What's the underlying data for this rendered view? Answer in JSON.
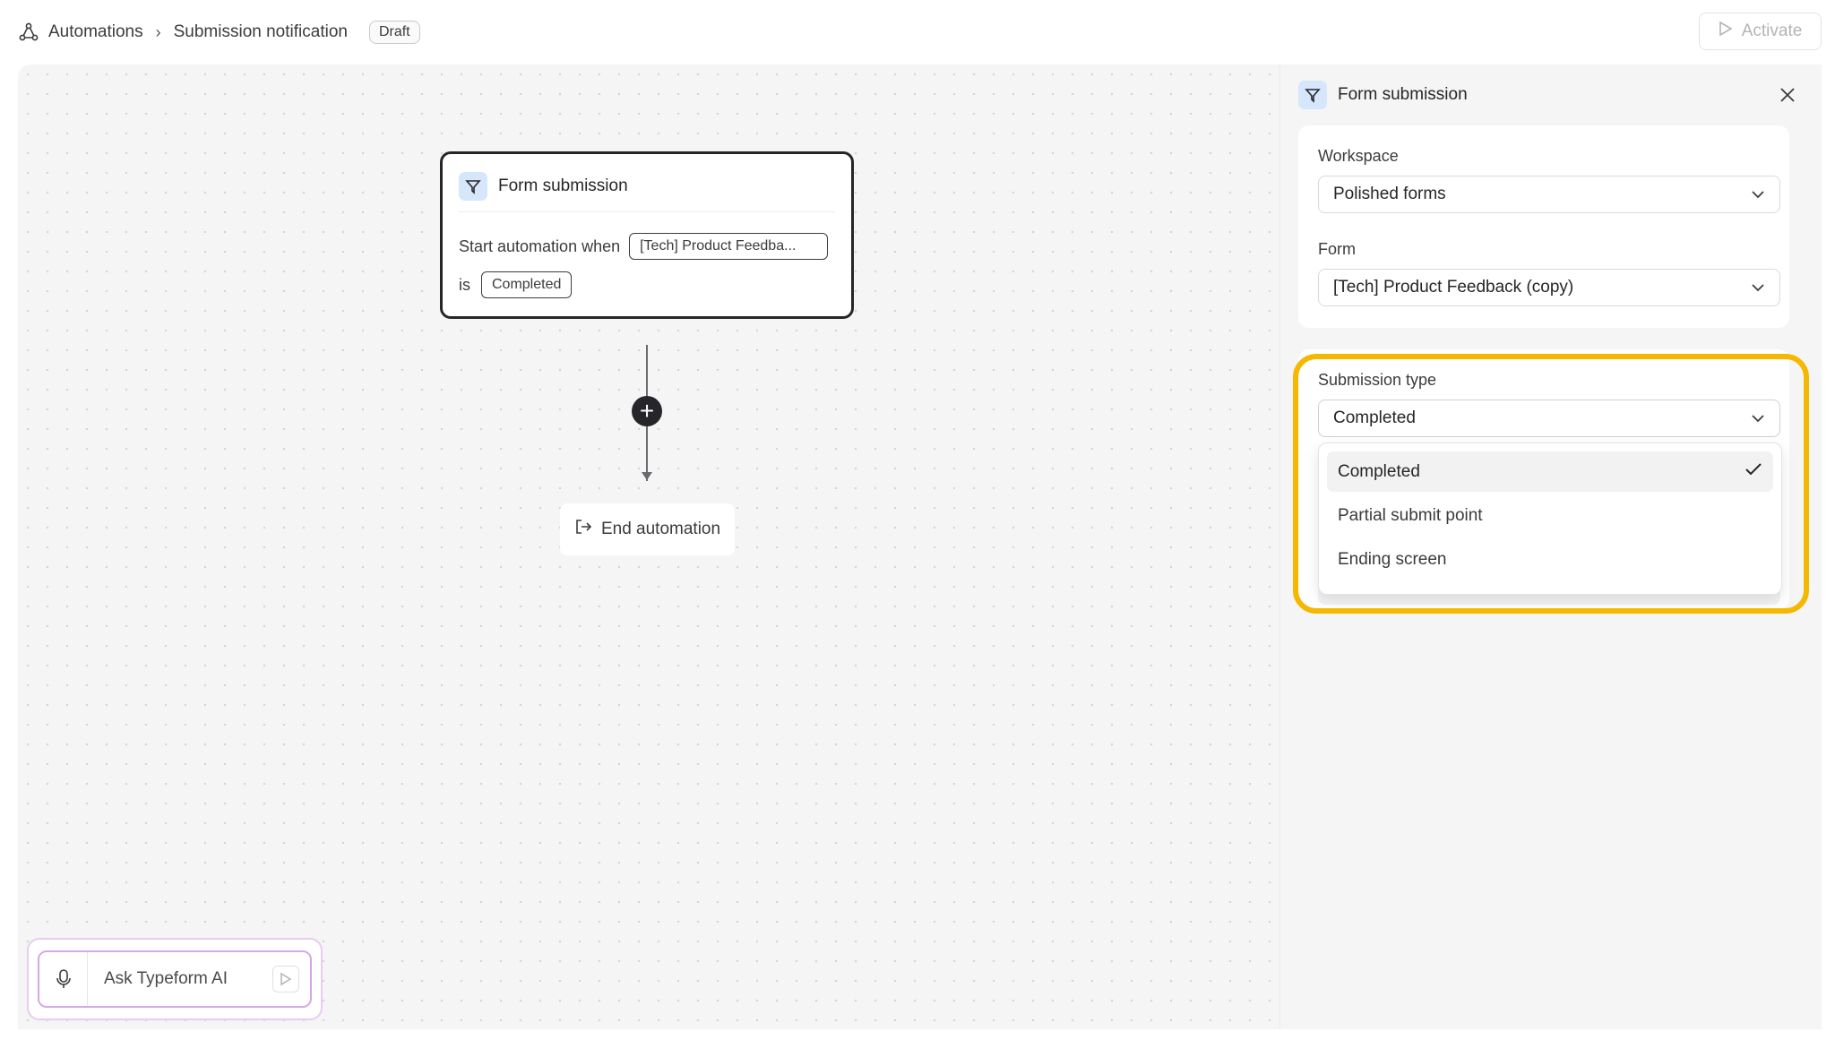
{
  "header": {
    "breadcrumb_root": "Automations",
    "breadcrumb_current": "Submission notification",
    "status_badge": "Draft",
    "activate_label": "Activate"
  },
  "canvas": {
    "trigger": {
      "title": "Form submission",
      "start_text": "Start automation when",
      "form_chip": "[Tech] Product Feedba...",
      "is_text": "is",
      "status_chip": "Completed"
    },
    "add_step_symbol": "+",
    "end_label": "End automation",
    "ai": {
      "placeholder": "Ask Typeform AI"
    }
  },
  "panel": {
    "title": "Form submission",
    "workspace_label": "Workspace",
    "workspace_value": "Polished forms",
    "form_label": "Form",
    "form_value": "[Tech] Product Feedback (copy)",
    "submission_type_label": "Submission type",
    "submission_type_value": "Completed",
    "options": [
      {
        "label": "Completed",
        "selected": true
      },
      {
        "label": "Partial submit point",
        "selected": false
      },
      {
        "label": "Ending screen",
        "selected": false
      }
    ]
  },
  "colors": {
    "highlight": "#f5b800",
    "trigger_icon_bg": "#d6e6fb",
    "ai_border": "#d7a8e4"
  },
  "icons": [
    "automation-icon",
    "chevron-right-icon",
    "play-icon",
    "filter-icon",
    "plus-icon",
    "exit-icon",
    "mic-icon",
    "send-icon",
    "close-icon",
    "chevron-down-icon",
    "check-icon"
  ]
}
